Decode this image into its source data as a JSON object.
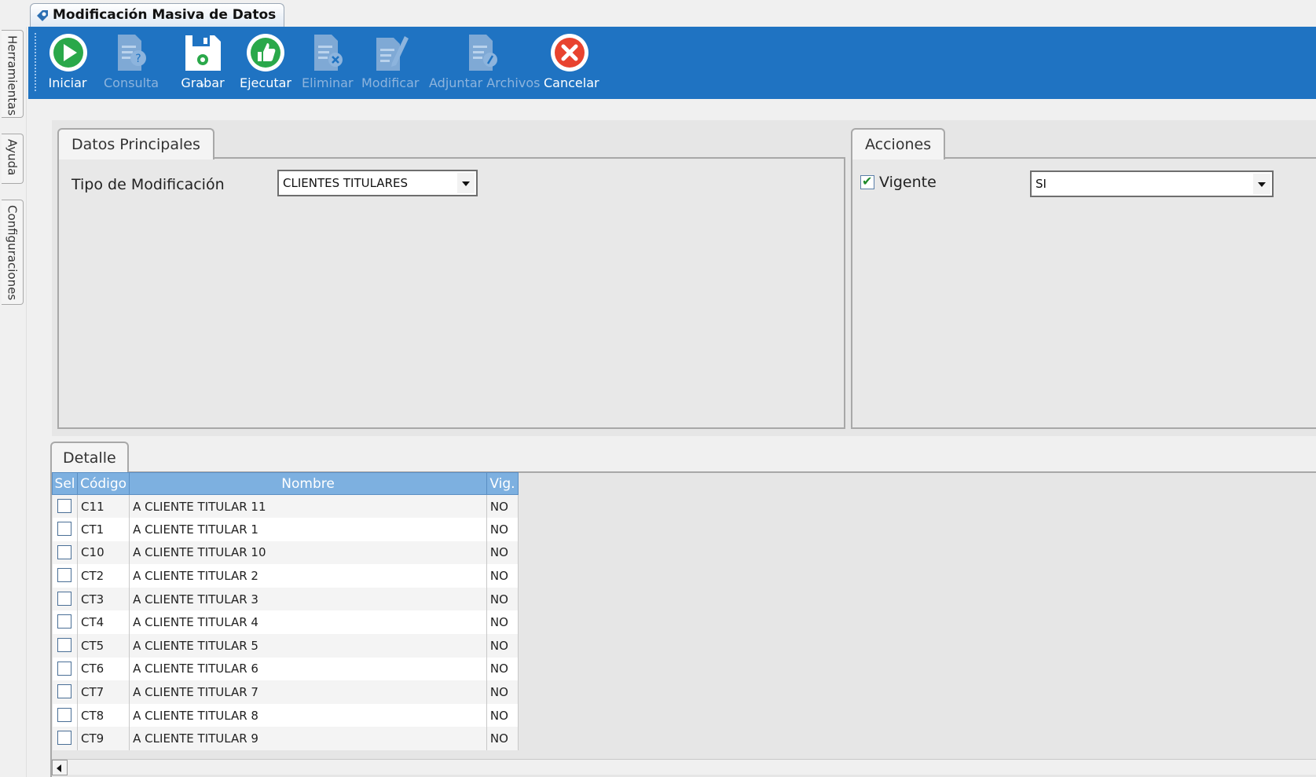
{
  "window": {
    "doc_tab_title": "Modificación Masiva de Datos"
  },
  "side_tabs": [
    "Herramientas",
    "Ayuda",
    "Configuraciones"
  ],
  "toolbar": {
    "buttons": [
      {
        "label": "Iniciar",
        "icon": "play-icon",
        "enabled": true
      },
      {
        "label": "Consulta",
        "icon": "document-question-icon",
        "enabled": false
      },
      {
        "label": "Grabar",
        "icon": "save-disk-icon",
        "enabled": true
      },
      {
        "label": "Ejecutar",
        "icon": "thumbs-up-icon",
        "enabled": true
      },
      {
        "label": "Eliminar",
        "icon": "document-delete-icon",
        "enabled": false
      },
      {
        "label": "Modificar",
        "icon": "document-edit-icon",
        "enabled": false
      },
      {
        "label": "Adjuntar Archivos",
        "icon": "document-attach-icon",
        "enabled": false
      },
      {
        "label": "Cancelar",
        "icon": "cancel-icon",
        "enabled": true
      }
    ],
    "colors": {
      "bar": "#1f73c2",
      "enabled_text": "#ffffff",
      "disabled_text": "#8db4dd"
    }
  },
  "datos_principales": {
    "title": "Datos Principales",
    "tipo_label": "Tipo de Modificación",
    "tipo_value": "CLIENTES TITULARES"
  },
  "acciones": {
    "title": "Acciones",
    "vigente_label": "Vigente",
    "vigente_checked": true,
    "vigente_value": "SI"
  },
  "detalle": {
    "title": "Detalle",
    "columns": [
      "Sel",
      "Código",
      "Nombre",
      "Vig."
    ],
    "rows": [
      {
        "code": "C11",
        "name": "A CLIENTE TITULAR  11",
        "vig": "NO"
      },
      {
        "code": "CT1",
        "name": "A CLIENTE TITULAR 1",
        "vig": "NO"
      },
      {
        "code": "C10",
        "name": "A CLIENTE TITULAR 10",
        "vig": "NO"
      },
      {
        "code": "CT2",
        "name": "A CLIENTE TITULAR 2",
        "vig": "NO"
      },
      {
        "code": "CT3",
        "name": "A CLIENTE TITULAR 3",
        "vig": "NO"
      },
      {
        "code": "CT4",
        "name": "A CLIENTE TITULAR 4",
        "vig": "NO"
      },
      {
        "code": "CT5",
        "name": "A CLIENTE TITULAR 5",
        "vig": "NO"
      },
      {
        "code": "CT6",
        "name": "A CLIENTE TITULAR 6",
        "vig": "NO"
      },
      {
        "code": "CT7",
        "name": "A CLIENTE TITULAR 7",
        "vig": "NO"
      },
      {
        "code": "CT8",
        "name": "A CLIENTE TITULAR 8",
        "vig": "NO"
      },
      {
        "code": "CT9",
        "name": "A CLIENTE TITULAR 9",
        "vig": "NO"
      }
    ]
  }
}
